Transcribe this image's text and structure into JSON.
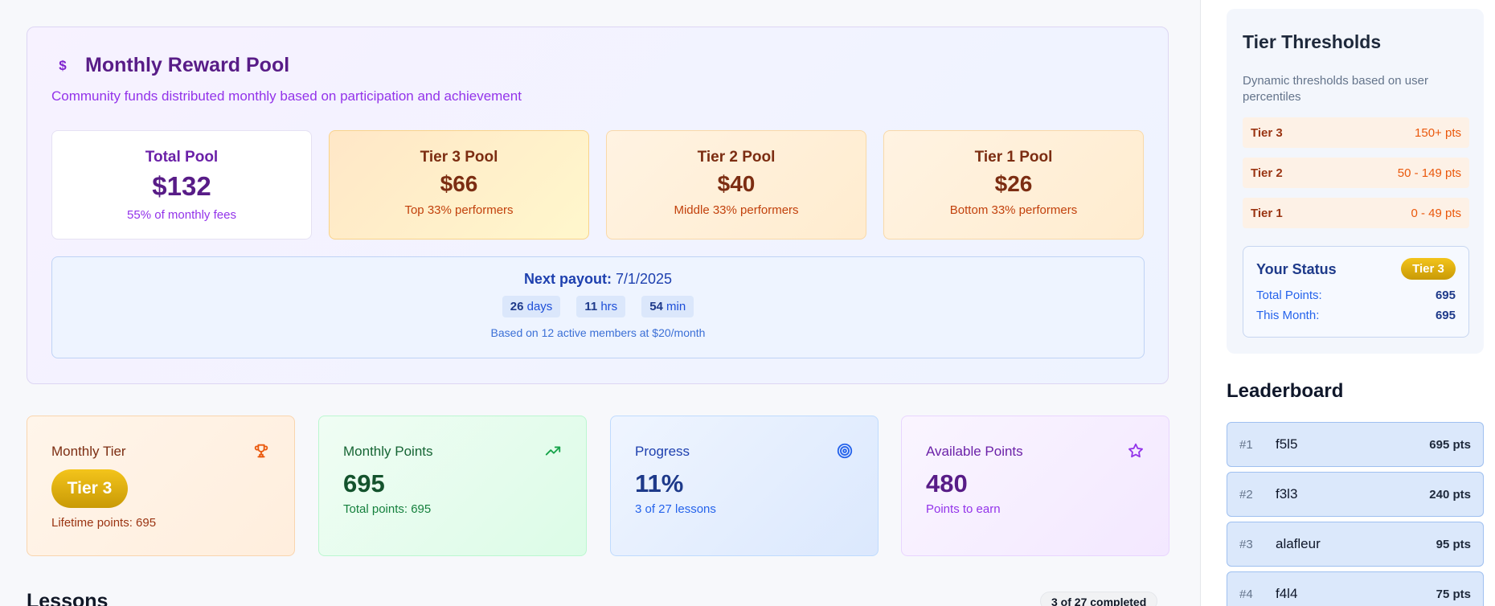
{
  "pool": {
    "title": "Monthly Reward Pool",
    "icon": "dollar-icon",
    "subtitle": "Community funds distributed monthly based on participation and achievement",
    "cards": [
      {
        "label": "Total Pool",
        "value": "$132",
        "note": "55% of monthly fees"
      },
      {
        "label": "Tier 3 Pool",
        "value": "$66",
        "note": "Top 33% performers"
      },
      {
        "label": "Tier 2 Pool",
        "value": "$40",
        "note": "Middle 33% performers"
      },
      {
        "label": "Tier 1 Pool",
        "value": "$26",
        "note": "Bottom 33% performers"
      }
    ],
    "payout": {
      "label": "Next payout:",
      "date": "7/1/2025",
      "days_num": "26",
      "days_unit": "days",
      "hrs_num": "11",
      "hrs_unit": "hrs",
      "min_num": "54",
      "min_unit": "min",
      "basis": "Based on 12 active members at $20/month"
    }
  },
  "stats": {
    "tier": {
      "label": "Monthly Tier",
      "icon": "trophy-icon",
      "value": "Tier 3",
      "note": "Lifetime points: 695"
    },
    "points": {
      "label": "Monthly Points",
      "icon": "trending-up-icon",
      "value": "695",
      "note": "Total points: 695"
    },
    "progress": {
      "label": "Progress",
      "icon": "target-icon",
      "value": "11%",
      "note": "3 of 27 lessons"
    },
    "available": {
      "label": "Available Points",
      "icon": "star-icon",
      "value": "480",
      "note": "Points to earn"
    }
  },
  "lessons": {
    "title": "Lessons",
    "badge": "3 of 27 completed"
  },
  "thresholds": {
    "title": "Tier Thresholds",
    "description": "Dynamic thresholds based on user percentiles",
    "rows": [
      {
        "name": "Tier 3",
        "range": "150+ pts"
      },
      {
        "name": "Tier 2",
        "range": "50 - 149 pts"
      },
      {
        "name": "Tier 1",
        "range": "0 - 49 pts"
      }
    ],
    "status": {
      "title": "Your Status",
      "badge": "Tier 3",
      "total_label": "Total Points:",
      "total_value": "695",
      "month_label": "This Month:",
      "month_value": "695"
    }
  },
  "leaderboard": {
    "title": "Leaderboard",
    "rows": [
      {
        "rank": "#1",
        "name": "f5l5",
        "pts": "695 pts"
      },
      {
        "rank": "#2",
        "name": "f3l3",
        "pts": "240 pts"
      },
      {
        "rank": "#3",
        "name": "alafleur",
        "pts": "95 pts"
      },
      {
        "rank": "#4",
        "name": "f4l4",
        "pts": "75 pts"
      }
    ]
  },
  "colors": {
    "accent_purple": "#581c87",
    "tier_gold": "#e0b00f",
    "blue": "#1e40af",
    "green": "#14532d",
    "orange": "#c2410c"
  }
}
